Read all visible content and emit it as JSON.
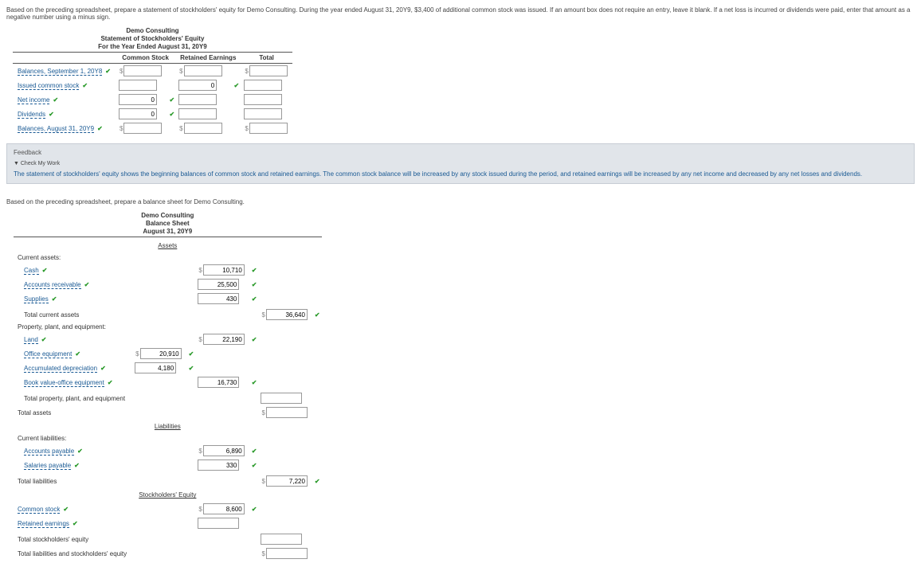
{
  "instr1": "Based on the preceding spreadsheet, prepare a statement of stockholders' equity for Demo Consulting. During the year ended August 31, 20Y9, $3,400 of additional common stock was issued. If an amount box does not require an entry, leave it blank. If a net loss is incurred or dividends were paid, enter that amount as a negative number using a minus sign.",
  "soe": {
    "company": "Demo Consulting",
    "title": "Statement of Stockholders' Equity",
    "period": "For the Year Ended August 31, 20Y9",
    "cols": {
      "c1": "Common Stock",
      "c2": "Retained Earnings",
      "c3": "Total"
    },
    "rows": {
      "r1": "Balances, September 1, 20Y8",
      "r2": "Issued common stock",
      "r3": "Net income",
      "r4": "Dividends",
      "r5": "Balances, August 31, 20Y9"
    },
    "vals": {
      "r2c2": "0",
      "r3c1": "0",
      "r4c1": "0"
    }
  },
  "feedback": {
    "title": "Feedback",
    "sub": "▼ Check My Work",
    "body": "The statement of stockholders' equity shows the beginning balances of common stock and retained earnings. The common stock balance will be increased by any stock issued during the period, and retained earnings will be increased by any net income and decreased by any net losses and dividends."
  },
  "instr2": "Based on the preceding spreadsheet, prepare a balance sheet for Demo Consulting.",
  "bs": {
    "company": "Demo Consulting",
    "title": "Balance Sheet",
    "date": "August 31, 20Y9",
    "heads": {
      "assets": "Assets",
      "liab": "Liabilities",
      "se": "Stockholders' Equity"
    },
    "labels": {
      "ca": "Current assets:",
      "cash": "Cash",
      "ar": "Accounts receivable",
      "supplies": "Supplies",
      "tca": "Total current assets",
      "ppe": "Property, plant, and equipment:",
      "land": "Land",
      "oe": "Office equipment",
      "ad": "Accumulated depreciation",
      "bvoe": "Book value-office equipment",
      "tppe": "Total property, plant, and equipment",
      "ta": "Total assets",
      "cl": "Current liabilities:",
      "ap": "Accounts payable",
      "sp": "Salaries payable",
      "tl": "Total liabilities",
      "cs": "Common stock",
      "re": "Retained earnings",
      "tse": "Total stockholders' equity",
      "tlse": "Total liabilities and stockholders' equity"
    },
    "vals": {
      "cash": "10,710",
      "ar": "25,500",
      "supplies": "430",
      "tca": "36,640",
      "land": "22,190",
      "oe": "20,910",
      "ad": "4,180",
      "bvoe": "16,730",
      "ap": "6,890",
      "sp": "330",
      "tl": "7,220",
      "cs": "8,600"
    }
  }
}
